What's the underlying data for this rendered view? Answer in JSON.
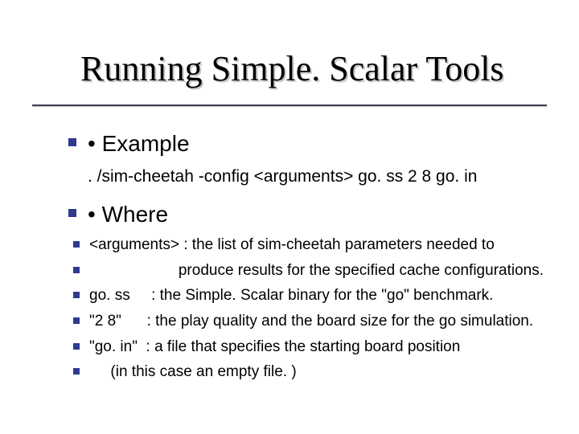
{
  "title": "Running Simple. Scalar Tools",
  "sections": {
    "example": {
      "heading": "• Example",
      "command": ". /sim-cheetah -config <arguments> go. ss 2 8 go. in"
    },
    "where": {
      "heading": "• Where",
      "lines": [
        "<arguments> : the list of sim-cheetah parameters needed to",
        "                     produce results for the specified cache configurations.",
        "go. ss     : the Simple. Scalar binary for the \"go\" benchmark.",
        "\"2 8\"      : the play quality and the board size for the go simulation.",
        "\"go. in\"  : a file that specifies the starting board position",
        "     (in this case an empty file. )"
      ]
    }
  }
}
